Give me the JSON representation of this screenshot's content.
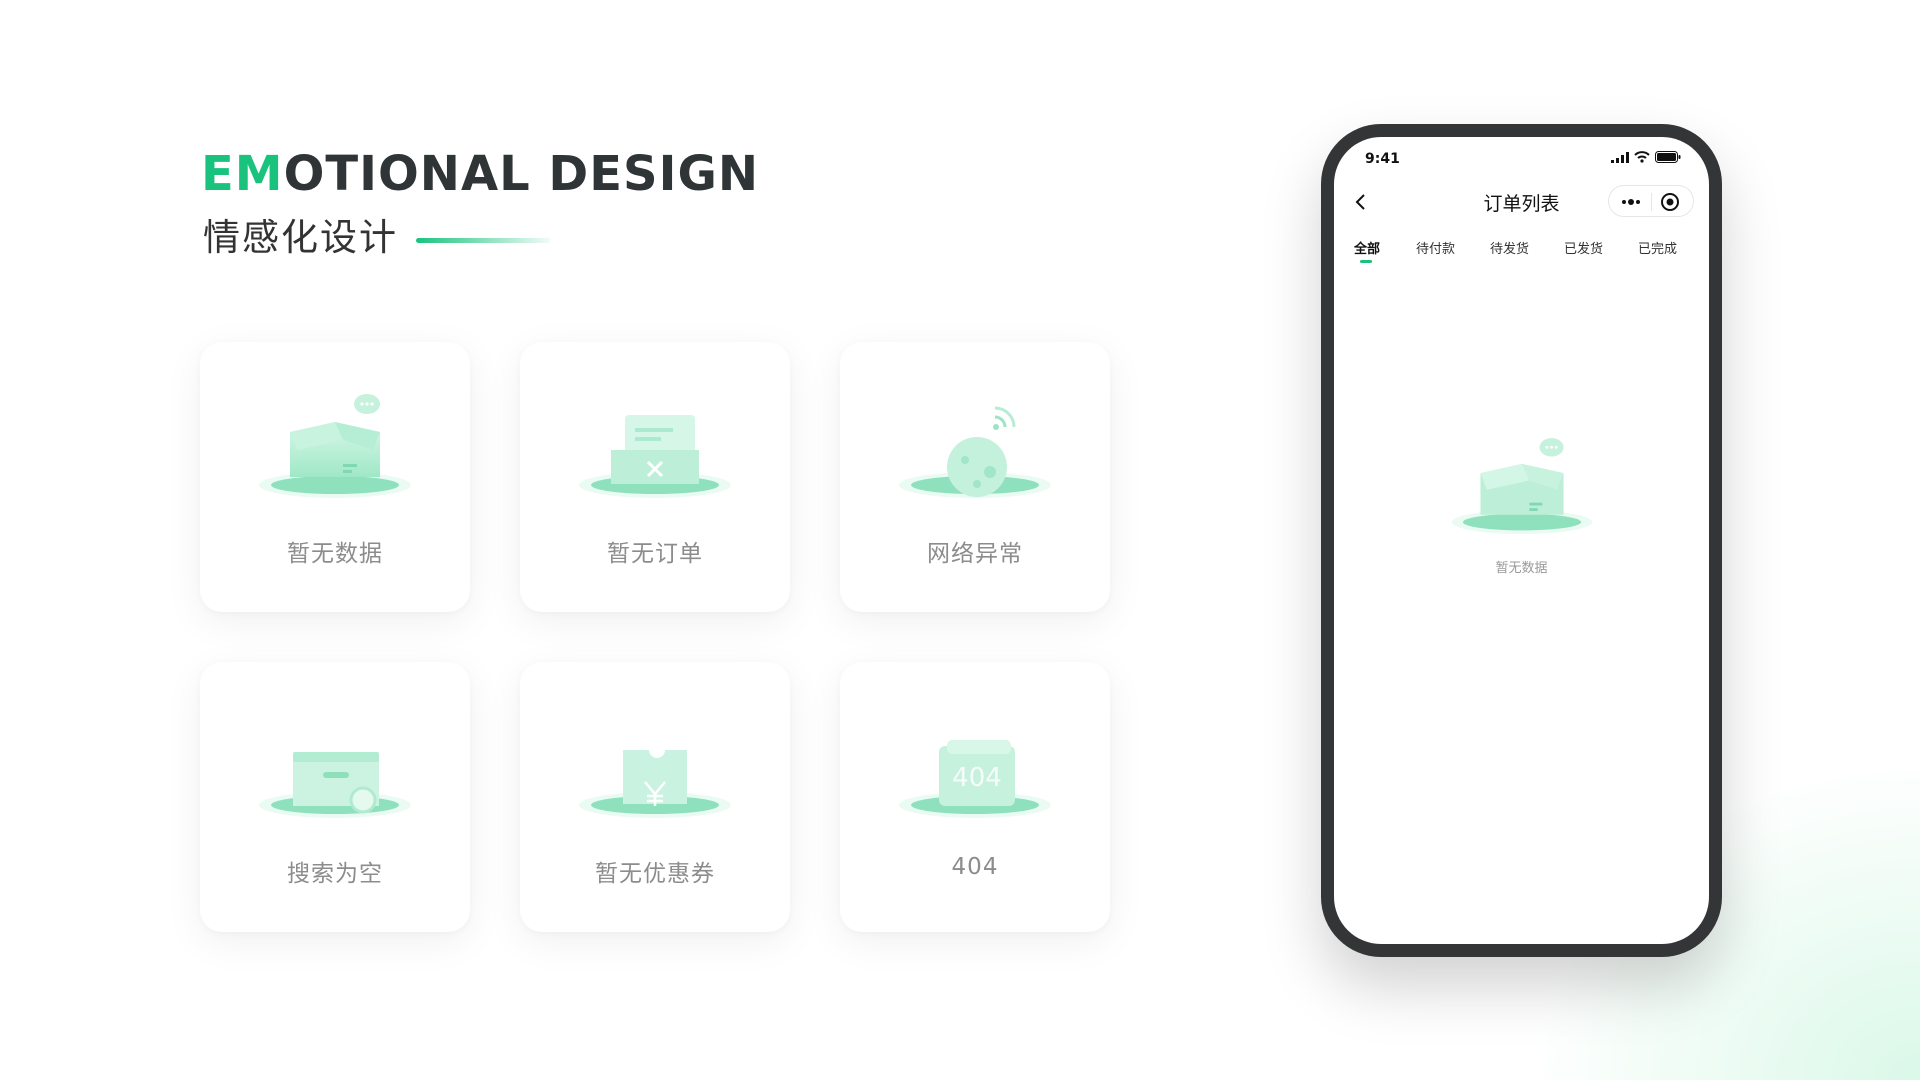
{
  "heading": {
    "accent": "EM",
    "rest": "OTIONAL DESIGN",
    "subtitle": "情感化设计"
  },
  "cards": [
    {
      "label": "暂无数据",
      "icon": "empty-box-icon"
    },
    {
      "label": "暂无订单",
      "icon": "empty-order-icon"
    },
    {
      "label": "网络异常",
      "icon": "network-error-icon"
    },
    {
      "label": "搜索为空",
      "icon": "empty-search-icon"
    },
    {
      "label": "暂无优惠券",
      "icon": "empty-coupon-icon"
    },
    {
      "label": "404",
      "icon": "not-found-icon"
    }
  ],
  "phone": {
    "status_time": "9:41",
    "title": "订单列表",
    "tabs": [
      {
        "label": "全部",
        "active": true
      },
      {
        "label": "待付款",
        "active": false
      },
      {
        "label": "待发货",
        "active": false
      },
      {
        "label": "已发货",
        "active": false
      },
      {
        "label": "已完成",
        "active": false
      }
    ],
    "empty_label": "暂无数据"
  },
  "colors": {
    "accent": "#19c37d",
    "text_dark": "#2f3437",
    "label_gray": "#8c8c8c",
    "phone_frame": "#333536"
  }
}
